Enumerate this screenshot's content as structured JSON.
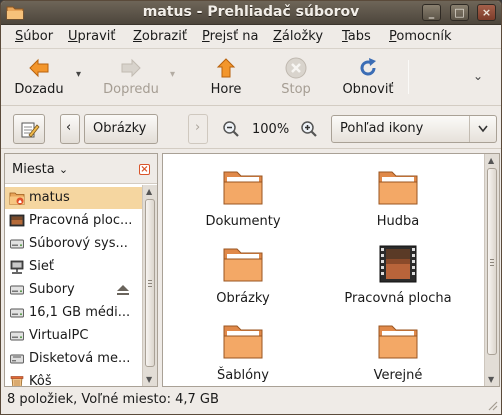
{
  "window": {
    "title": "matus - Prehliadač súborov",
    "buttons": [
      "minimize",
      "maximize",
      "close"
    ]
  },
  "menubar": {
    "items": [
      {
        "label": "Súbor",
        "underline": "S",
        "rest": "úbor"
      },
      {
        "label": "Upraviť",
        "underline": "U",
        "rest": "praviť"
      },
      {
        "label": "Zobraziť",
        "underline": "Z",
        "rest": "obraziť"
      },
      {
        "label": "Prejsť na",
        "underline": "P",
        "rest": "rejsť na"
      },
      {
        "label": "Záložky",
        "underline": "Z",
        "rest": "áložky"
      },
      {
        "label": "Tabs",
        "underline": "T",
        "rest": "abs"
      },
      {
        "label": "Pomocník",
        "underline": "P",
        "rest": "omocník"
      }
    ]
  },
  "toolbar": {
    "back_label": "Dozadu",
    "forward_label": "Dopredu",
    "up_label": "Hore",
    "stop_label": "Stop",
    "reload_label": "Obnoviť"
  },
  "location": {
    "path_button": "Obrázky",
    "zoom": "100%",
    "view_mode": "Pohľad ikony"
  },
  "sidepane": {
    "title": "Miesta",
    "items": [
      {
        "label": "matus",
        "icon": "home-folder-icon",
        "selected": true
      },
      {
        "label": "Pracovná ploc...",
        "icon": "desktop-icon"
      },
      {
        "label": "Súborový sys...",
        "icon": "drive-icon"
      },
      {
        "label": "Sieť",
        "icon": "network-icon"
      },
      {
        "label": "Subory",
        "icon": "drive-icon",
        "eject": true
      },
      {
        "label": "16,1 GB médi...",
        "icon": "drive-icon"
      },
      {
        "label": "VirtualPC",
        "icon": "drive-icon"
      },
      {
        "label": "Disketová me...",
        "icon": "floppy-icon"
      },
      {
        "label": "Kôš",
        "icon": "trash-icon"
      }
    ]
  },
  "files": [
    {
      "name": "Dokumenty",
      "icon": "folder-icon"
    },
    {
      "name": "Hudba",
      "icon": "folder-icon"
    },
    {
      "name": "Obrázky",
      "icon": "folder-icon"
    },
    {
      "name": "Pracovná plocha",
      "icon": "desktop-folder-icon"
    },
    {
      "name": "Šablóny",
      "icon": "folder-icon"
    },
    {
      "name": "Verejné",
      "icon": "folder-icon"
    }
  ],
  "status": {
    "text": "8 položiek, Voľné miesto: 4,7 GB"
  },
  "colors": {
    "accent_orange": "#f08a24",
    "selection": "#f5d6a0",
    "titlebar": "#5a5246"
  }
}
